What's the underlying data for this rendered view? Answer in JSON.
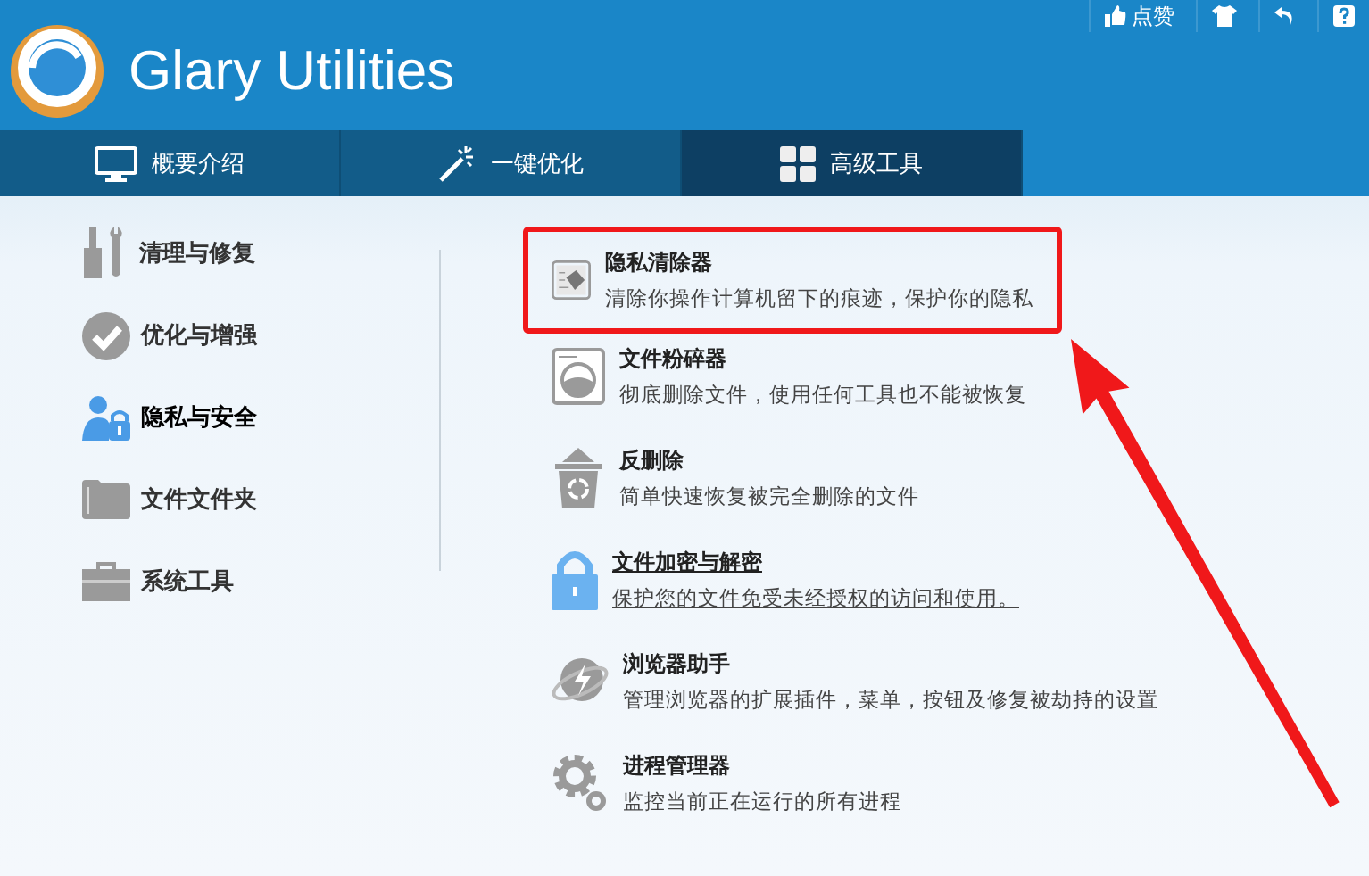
{
  "app": {
    "title": "Glary Utilities"
  },
  "top_actions": [
    {
      "kind": "like",
      "label": "点赞"
    },
    {
      "kind": "skin"
    },
    {
      "kind": "undo"
    },
    {
      "kind": "help"
    }
  ],
  "tabs": [
    {
      "kind": "monitor",
      "label": "概要介绍",
      "selected": false
    },
    {
      "kind": "wand",
      "label": "一键优化",
      "selected": false
    },
    {
      "kind": "grid",
      "label": "高级工具",
      "selected": true
    }
  ],
  "sidebar": {
    "items": [
      {
        "kind": "clean",
        "label": "清理与修复",
        "selected": false
      },
      {
        "kind": "optimize",
        "label": "优化与增强",
        "selected": false
      },
      {
        "kind": "privacy",
        "label": "隐私与安全",
        "selected": true
      },
      {
        "kind": "folder",
        "label": "文件文件夹",
        "selected": false
      },
      {
        "kind": "toolbox",
        "label": "系统工具",
        "selected": false
      }
    ]
  },
  "tools": [
    {
      "kind": "eraser",
      "title": "隐私清除器",
      "description": "清除你操作计算机留下的痕迹，保护你的隐私",
      "hovered": false,
      "highlighted": true
    },
    {
      "kind": "shredder",
      "title": "文件粉碎器",
      "description": "彻底删除文件，使用任何工具也不能被恢复",
      "hovered": false
    },
    {
      "kind": "undelete",
      "title": "反删除",
      "description": "简单快速恢复被完全删除的文件",
      "hovered": false
    },
    {
      "kind": "lock",
      "title": "文件加密与解密",
      "description": "保护您的文件免受未经授权的访问和使用。",
      "hovered": true
    },
    {
      "kind": "browser",
      "title": "浏览器助手",
      "description": "管理浏览器的扩展插件，菜单，按钮及修复被劫持的设置",
      "hovered": false
    },
    {
      "kind": "process",
      "title": "进程管理器",
      "description": "监控当前正在运行的所有进程",
      "hovered": false
    }
  ]
}
